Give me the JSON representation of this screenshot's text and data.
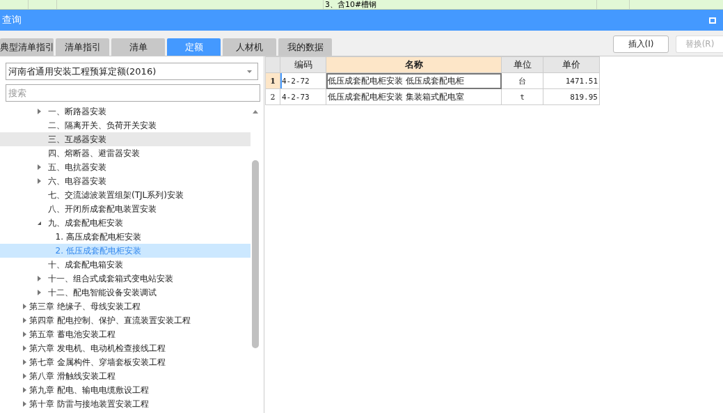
{
  "top_strip": {
    "cell_text": "3、含10#槽钢"
  },
  "window": {
    "title": "查询"
  },
  "tabs": [
    {
      "label": "典型清单指引",
      "selected": false
    },
    {
      "label": "清单指引",
      "selected": false
    },
    {
      "label": "清单",
      "selected": false
    },
    {
      "label": "定额",
      "selected": true
    },
    {
      "label": "人材机",
      "selected": false
    },
    {
      "label": "我的数据",
      "selected": false
    }
  ],
  "quota_library": {
    "value": "河南省通用安装工程预算定额(2016)"
  },
  "search": {
    "placeholder": "搜索"
  },
  "tree": {
    "items": [
      {
        "kind": "hidden",
        "children": [
          {
            "kind": "hidden",
            "children": [
              {
                "kind": "folder",
                "expanded": false,
                "selected": false,
                "hovered": false,
                "number": "一、",
                "label": "断路器安装"
              },
              {
                "kind": "leaf",
                "selected": false,
                "hovered": false,
                "number": "二、",
                "label": "隔离开关、负荷开关安装"
              },
              {
                "kind": "leaf",
                "selected": false,
                "hovered": true,
                "number": "三、",
                "label": "互感器安装"
              },
              {
                "kind": "leaf",
                "selected": false,
                "hovered": false,
                "number": "四、",
                "label": "熔断器、避雷器安装"
              },
              {
                "kind": "folder",
                "expanded": false,
                "selected": false,
                "hovered": false,
                "number": "五、",
                "label": "电抗器安装"
              },
              {
                "kind": "folder",
                "expanded": false,
                "selected": false,
                "hovered": false,
                "number": "六、",
                "label": "电容器安装"
              },
              {
                "kind": "leaf",
                "selected": false,
                "hovered": false,
                "number": "七、",
                "label": "交流滤波装置组架(TJL系列)安装"
              },
              {
                "kind": "leaf",
                "selected": false,
                "hovered": false,
                "number": "八、",
                "label": "开闭所成套配电装置安装"
              },
              {
                "kind": "folder",
                "expanded": true,
                "selected": false,
                "hovered": false,
                "number": "九、",
                "label": "成套配电柜安装",
                "children": [
                  {
                    "kind": "leaf",
                    "selected": false,
                    "hovered": false,
                    "label": "1. 高压成套配电柜安装"
                  },
                  {
                    "kind": "leaf",
                    "selected": true,
                    "hovered": false,
                    "label": "2. 低压成套配电柜安装"
                  }
                ]
              },
              {
                "kind": "leaf",
                "selected": false,
                "hovered": false,
                "number": "十、",
                "label": "成套配电箱安装"
              },
              {
                "kind": "folder",
                "expanded": false,
                "selected": false,
                "hovered": false,
                "number": "十一、",
                "label": "组合式成套箱式变电站安装"
              },
              {
                "kind": "folder",
                "expanded": false,
                "selected": false,
                "hovered": false,
                "number": "十二、",
                "label": "配电智能设备安装调试"
              }
            ]
          }
        ]
      },
      {
        "kind": "folder",
        "expanded": false,
        "selected": false,
        "hovered": false,
        "label": "第三章 绝缘子、母线安装工程"
      },
      {
        "kind": "folder",
        "expanded": false,
        "selected": false,
        "hovered": false,
        "label": "第四章 配电控制、保护、直流装置安装工程"
      },
      {
        "kind": "folder",
        "expanded": false,
        "selected": false,
        "hovered": false,
        "label": "第五章 蓄电池安装工程"
      },
      {
        "kind": "folder",
        "expanded": false,
        "selected": false,
        "hovered": false,
        "label": "第六章 发电机、电动机检查接线工程"
      },
      {
        "kind": "folder",
        "expanded": false,
        "selected": false,
        "hovered": false,
        "label": "第七章 金属构件、穿墙套板安装工程"
      },
      {
        "kind": "folder",
        "expanded": false,
        "selected": false,
        "hovered": false,
        "label": "第八章 滑触线安装工程"
      },
      {
        "kind": "folder",
        "expanded": false,
        "selected": false,
        "hovered": false,
        "label": "第九章 配电、输电电缆敷设工程"
      },
      {
        "kind": "folder",
        "expanded": false,
        "selected": false,
        "hovered": false,
        "label": "第十章 防雷与接地装置安装工程"
      }
    ]
  },
  "buttons": [
    {
      "label": "插入(I)",
      "disabled": false
    },
    {
      "label": "替换(R)",
      "disabled": true
    }
  ],
  "table": {
    "columns": [
      {
        "label": "编码",
        "selected": false
      },
      {
        "label": "名称",
        "selected": true
      },
      {
        "label": "单位",
        "selected": false
      },
      {
        "label": "单价",
        "selected": false
      }
    ],
    "rows": [
      {
        "number": "1",
        "selected": true,
        "cells": [
          "4-2-72",
          "低压成套配电柜安装 低压成套配电柜",
          "台",
          "1471.51"
        ]
      },
      {
        "number": "2",
        "selected": false,
        "cells": [
          "4-2-73",
          "低压成套配电柜安装 集装箱式配电室",
          "t",
          "819.95"
        ]
      }
    ]
  }
}
